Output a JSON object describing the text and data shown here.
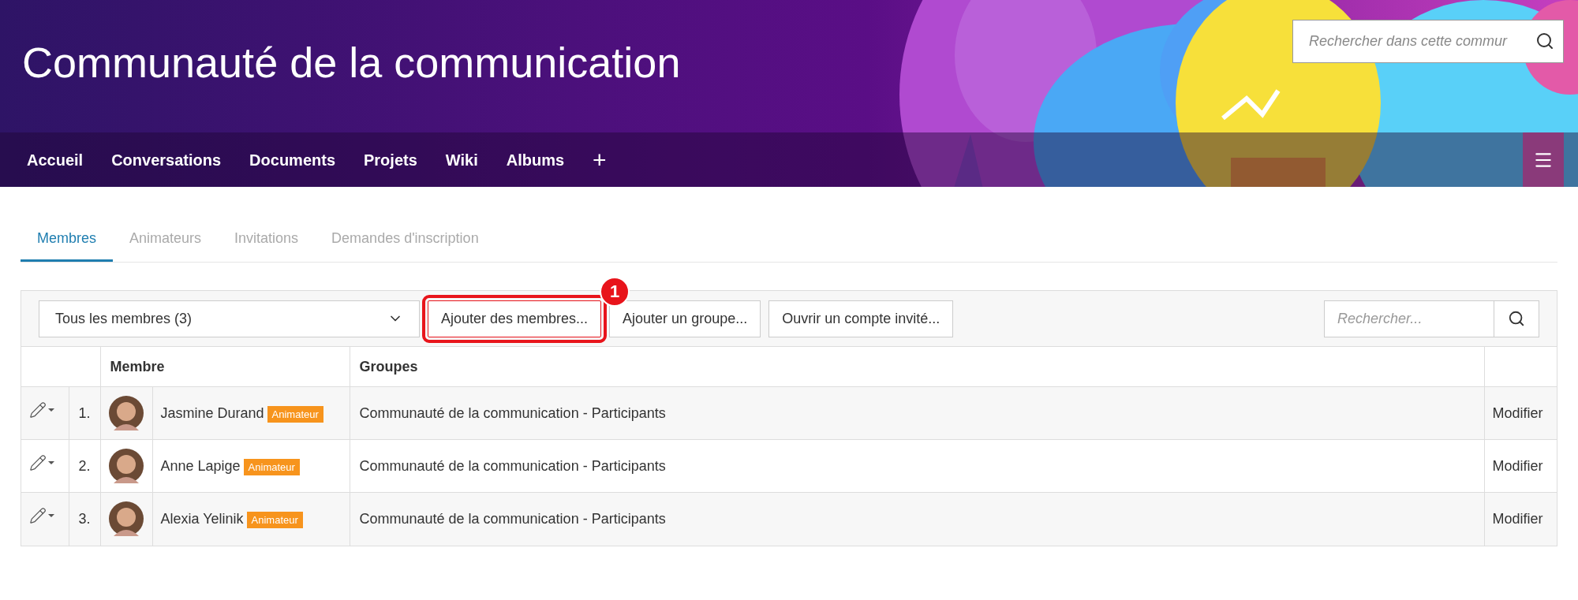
{
  "header": {
    "title": "Communauté de la communication",
    "search": {
      "placeholder": "Rechercher dans cette commur"
    },
    "nav": [
      {
        "label": "Accueil"
      },
      {
        "label": "Conversations"
      },
      {
        "label": "Documents"
      },
      {
        "label": "Projets"
      },
      {
        "label": "Wiki"
      },
      {
        "label": "Albums"
      },
      {
        "label": "+"
      }
    ]
  },
  "tabs": [
    {
      "label": "Membres",
      "selected": true
    },
    {
      "label": "Animateurs",
      "selected": false
    },
    {
      "label": "Invitations",
      "selected": false
    },
    {
      "label": "Demandes d'inscription",
      "selected": false
    }
  ],
  "toolbar": {
    "filter": "Tous les membres (3)",
    "buttons": [
      {
        "label": "Ajouter des membres...",
        "highlighted": true,
        "callout": "1"
      },
      {
        "label": "Ajouter un groupe...",
        "highlighted": false
      },
      {
        "label": "Ouvrir un compte invité...",
        "highlighted": false
      }
    ],
    "search": {
      "placeholder": "Rechercher..."
    }
  },
  "table": {
    "columns": [
      "Membre",
      "Groupes"
    ],
    "rows": [
      {
        "index": "1.",
        "name": "Jasmine Durand",
        "badge": "Animateur",
        "group": "Communauté de la communication - Participants",
        "action": "Modifier"
      },
      {
        "index": "2.",
        "name": "Anne Lapige",
        "badge": "Animateur",
        "group": "Communauté de la communication - Participants",
        "action": "Modifier"
      },
      {
        "index": "3.",
        "name": "Alexia Yelinik",
        "badge": "Animateur",
        "group": "Communauté de la communication - Participants",
        "action": "Modifier"
      }
    ]
  }
}
